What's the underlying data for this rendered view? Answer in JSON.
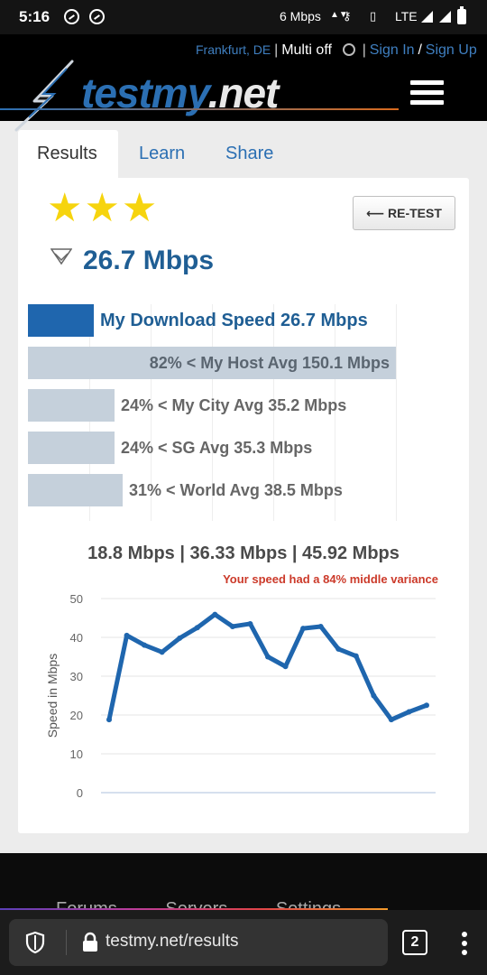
{
  "status_bar": {
    "time": "5:16",
    "net_speed": "6 Mbps",
    "network": "LTE",
    "icons": [
      "notification-icon",
      "notification-icon",
      "vpn-key-icon",
      "vibrate-icon",
      "signal-icon",
      "signal-icon",
      "battery-icon"
    ]
  },
  "header": {
    "location": "Frankfurt, DE",
    "sep1": "|",
    "multi": "Multi off",
    "sep2": "|",
    "sign_in": "Sign In",
    "slash": "/",
    "sign_up": "Sign Up",
    "logo_main": "testmy",
    "logo_tld": ".net"
  },
  "tabs": [
    {
      "label": "Results",
      "active": true
    },
    {
      "label": "Learn",
      "active": false
    },
    {
      "label": "Share",
      "active": false
    }
  ],
  "result": {
    "stars": "★★★",
    "star_rating": 3,
    "retest_label": "⟵ RE-TEST",
    "speed": "26.7 Mbps"
  },
  "comparison": [
    {
      "label": "My Download Speed 26.7 Mbps",
      "value": 26.7,
      "type": "mine"
    },
    {
      "label": "82% < My Host Avg 150.1 Mbps",
      "value": 150.1,
      "type": "avg"
    },
    {
      "label": "24% < My City Avg 35.2 Mbps",
      "value": 35.2,
      "type": "avg"
    },
    {
      "label": "24% < SG Avg 35.3 Mbps",
      "value": 35.3,
      "type": "avg"
    },
    {
      "label": "31% < World Avg 38.5 Mbps",
      "value": 38.5,
      "type": "avg"
    }
  ],
  "stats": {
    "line": "18.8 Mbps | 36.33 Mbps | 45.92 Mbps",
    "variance": "Your speed had a 84% middle variance"
  },
  "chart_data": {
    "type": "line",
    "ylabel": "Speed in Mbps",
    "xlabel": "",
    "ylim": [
      0,
      50
    ],
    "yticks": [
      0,
      10,
      20,
      30,
      40,
      50
    ],
    "grid": true,
    "series": [
      {
        "values": [
          18.8,
          40.5,
          38.0,
          36.2,
          39.8,
          42.5,
          45.9,
          42.8,
          43.5,
          35.0,
          32.5,
          42.3,
          42.8,
          37.0,
          35.2,
          25.0,
          18.8,
          20.8,
          22.5
        ],
        "color": "#1f66ae"
      }
    ]
  },
  "footer": {
    "links": [
      "Forums",
      "Servers",
      "Settings"
    ]
  },
  "browser": {
    "url": "testmy.net/results",
    "tab_count": "2"
  }
}
